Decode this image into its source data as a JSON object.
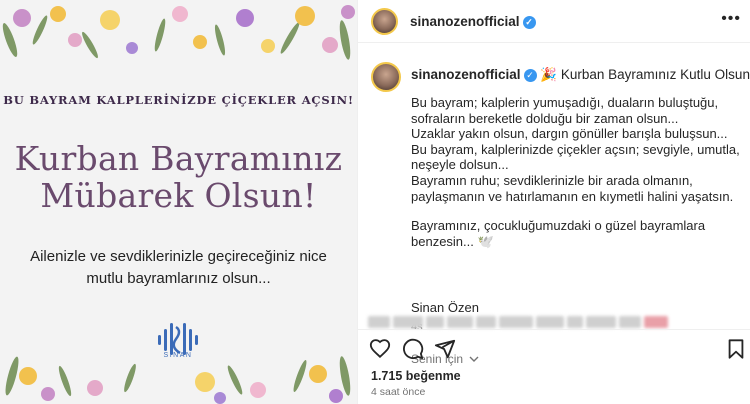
{
  "image": {
    "tagline": "BU BAYRAM KALPLERİNİZDE ÇİÇEKLER AÇSIN!",
    "title_line1": "Kurban Bayramınız",
    "title_line2": "Mübarek Olsun!",
    "body_line1": "Ailenizle ve sevdiklerinizle geçireceğiniz nice",
    "body_line2": "mutlu bayramlarınız olsun...",
    "logo_text": "SİNAN"
  },
  "header": {
    "username": "sinanozenofficial",
    "more_label": "•••"
  },
  "caption": {
    "username": "sinanozenofficial",
    "first_line": "🎉 Kurban Bayramınız Kutlu Olsun 🌿",
    "p1": "Bu bayram; kalplerin yumuşadığı, duaların buluştuğu, sofraların bereketle dolduğu bir zaman olsun...",
    "p2": "Uzaklar yakın olsun, dargın gönüller barışla buluşsun...",
    "p3": "Bu bayram, kalplerinizde çiçekler açsın; sevgiyle, umutla, neşeyle dolsun...",
    "p4": "Bayramın ruhu; sevdiklerinizle bir arada olmanın, paylaşmanın ve hatırlamanın en kıymetli halini yaşatsın.",
    "p5": "Bayramınız, çocukluğumuzdaki o güzel bayramlara benzesin... 🕊️",
    "signature": "Sinan Özen",
    "relative_time": "4s",
    "translation_label": "Senin için"
  },
  "footer": {
    "likes": "1.715 beğenme",
    "time_ago": "4 saat önce"
  },
  "colors": {
    "verified": "#3897f0",
    "title_purple": "#6a4a6d",
    "secondary_text": "#737373"
  },
  "icons": [
    "heart-icon",
    "comment-icon",
    "share-icon",
    "bookmark-icon",
    "verified-icon",
    "more-icon",
    "chevron-down-icon"
  ]
}
